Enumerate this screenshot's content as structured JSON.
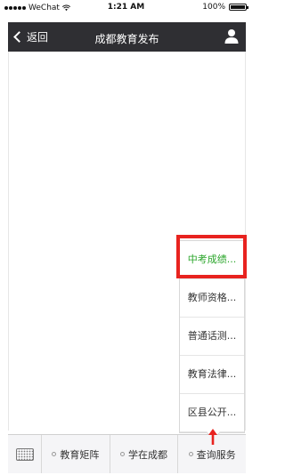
{
  "status_bar": {
    "carrier": "WeChat",
    "time": "1:21 AM",
    "battery": "100%"
  },
  "nav": {
    "back_label": "返回",
    "title": "成都教育发布"
  },
  "popup_menu": {
    "items": [
      {
        "label": "中考成绩..."
      },
      {
        "label": "教师资格..."
      },
      {
        "label": "普通话测..."
      },
      {
        "label": "教育法律..."
      },
      {
        "label": "区县公开..."
      }
    ]
  },
  "bottom_menu": {
    "tabs": [
      {
        "label": "教育矩阵"
      },
      {
        "label": "学在成都"
      },
      {
        "label": "查询服务"
      }
    ]
  },
  "colors": {
    "nav_bg": "#2f2f33",
    "highlight_text": "#2aa52a",
    "annotation_red": "#e8231f"
  }
}
